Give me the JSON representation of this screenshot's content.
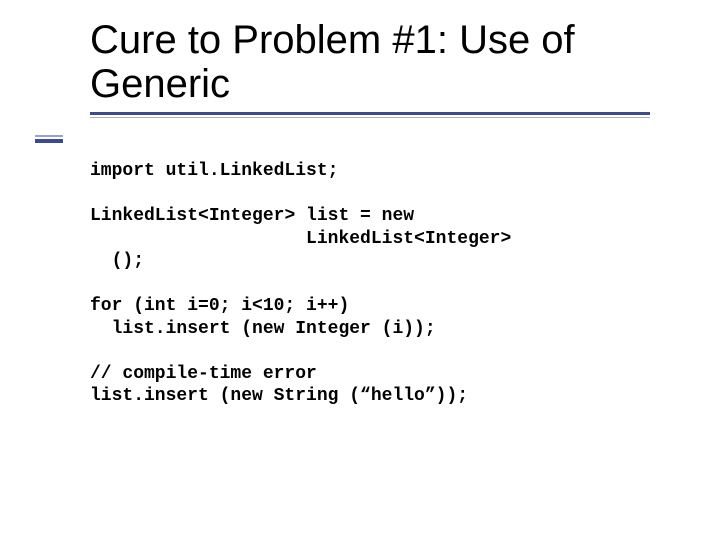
{
  "title": "Cure to Problem #1: Use of Generic",
  "code": {
    "l1a": "import util.LinkedList;",
    "l2a": "LinkedList",
    "l2b": "<Integer>",
    "l2c": " list = new",
    "l3a": "                    LinkedList",
    "l3b": "<Integer>",
    "l4a": "  ();",
    "l5a": "for (int i=0; i<10; i++)",
    "l6a": "  list.insert (new Integer (i));",
    "l7a": "// compile-time error",
    "l8a": "list.insert (new String (“hello”));"
  }
}
